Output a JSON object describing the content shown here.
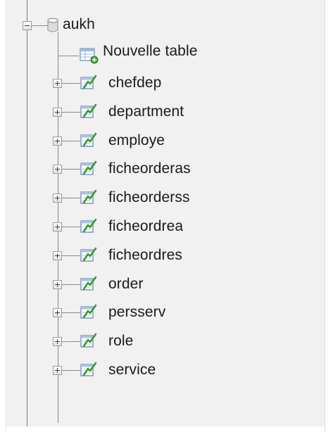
{
  "tree": {
    "database": {
      "name": "aukh",
      "icon": "database-icon",
      "expanded": true
    },
    "new_table": {
      "label": "Nouvelle table",
      "icon": "new-table-icon"
    },
    "tables": [
      {
        "name": "chefdep",
        "icon": "table-structure-icon"
      },
      {
        "name": "department",
        "icon": "table-structure-icon"
      },
      {
        "name": "employe",
        "icon": "table-structure-icon"
      },
      {
        "name": "ficheorderas",
        "icon": "table-structure-icon"
      },
      {
        "name": "ficheorderss",
        "icon": "table-structure-icon"
      },
      {
        "name": "ficheordrea",
        "icon": "table-structure-icon"
      },
      {
        "name": "ficheordres",
        "icon": "table-structure-icon"
      },
      {
        "name": "order",
        "icon": "table-structure-icon"
      },
      {
        "name": "persserv",
        "icon": "table-structure-icon"
      },
      {
        "name": "role",
        "icon": "table-structure-icon"
      },
      {
        "name": "service",
        "icon": "table-structure-icon"
      }
    ]
  },
  "colors": {
    "panel_bg": "#f1f1f1",
    "tree_line": "#8a8a8a",
    "text": "#1a1a1a",
    "table_icon_accent": "#3a9a2a",
    "table_icon_frame": "#5a7fb0"
  }
}
